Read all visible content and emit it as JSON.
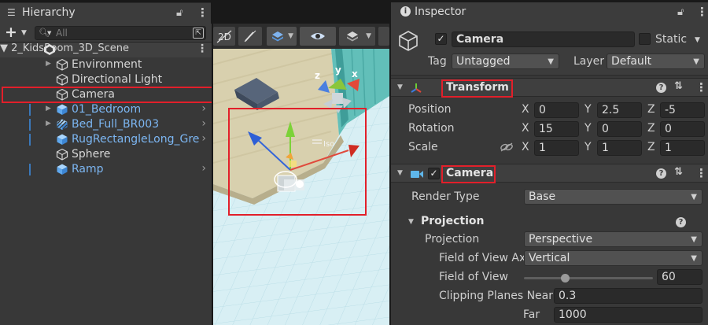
{
  "hierarchy": {
    "tab_title": "Hierarchy",
    "search_placeholder": "All",
    "scene_name": "2_KidsRoom_3D_Scene",
    "items": [
      {
        "label": "Environment"
      },
      {
        "label": "Directional Light"
      },
      {
        "label": "Camera"
      },
      {
        "label": "01_Bedroom"
      },
      {
        "label": "Bed_Full_BR003"
      },
      {
        "label": "RugRectangleLong_Gre"
      },
      {
        "label": "Sphere"
      },
      {
        "label": "Ramp"
      }
    ]
  },
  "scene": {
    "gizmo_labels": {
      "x": "x",
      "y": "y",
      "z": "z"
    },
    "iso_label": "Iso"
  },
  "inspector": {
    "tab_title": "Inspector",
    "object_name": "Camera",
    "static_label": "Static",
    "tag_label": "Tag",
    "tag_value": "Untagged",
    "layer_label": "Layer",
    "layer_value": "Default",
    "transform": {
      "title": "Transform",
      "position_label": "Position",
      "rotation_label": "Rotation",
      "scale_label": "Scale",
      "axis_x": "X",
      "axis_y": "Y",
      "axis_z": "Z",
      "position": {
        "x": "0",
        "y": "2.5",
        "z": "-5"
      },
      "rotation": {
        "x": "15",
        "y": "0",
        "z": "0"
      },
      "scale": {
        "x": "1",
        "y": "1",
        "z": "1"
      }
    },
    "camera": {
      "title": "Camera",
      "render_type_label": "Render Type",
      "render_type_value": "Base",
      "projection_section": "Projection",
      "projection_label": "Projection",
      "projection_value": "Perspective",
      "fov_axis_label": "Field of View Ax",
      "fov_axis_value": "Vertical",
      "fov_label": "Field of View",
      "fov_value": "60",
      "fov_level_percent": 31,
      "clipping_label": "Clipping Planes Near",
      "near_value": "0.3",
      "far_label": "Far",
      "far_value": "1000"
    }
  },
  "colors": {
    "highlight_red": "#e21f2a",
    "prefab_blue": "#7cb6f2"
  }
}
